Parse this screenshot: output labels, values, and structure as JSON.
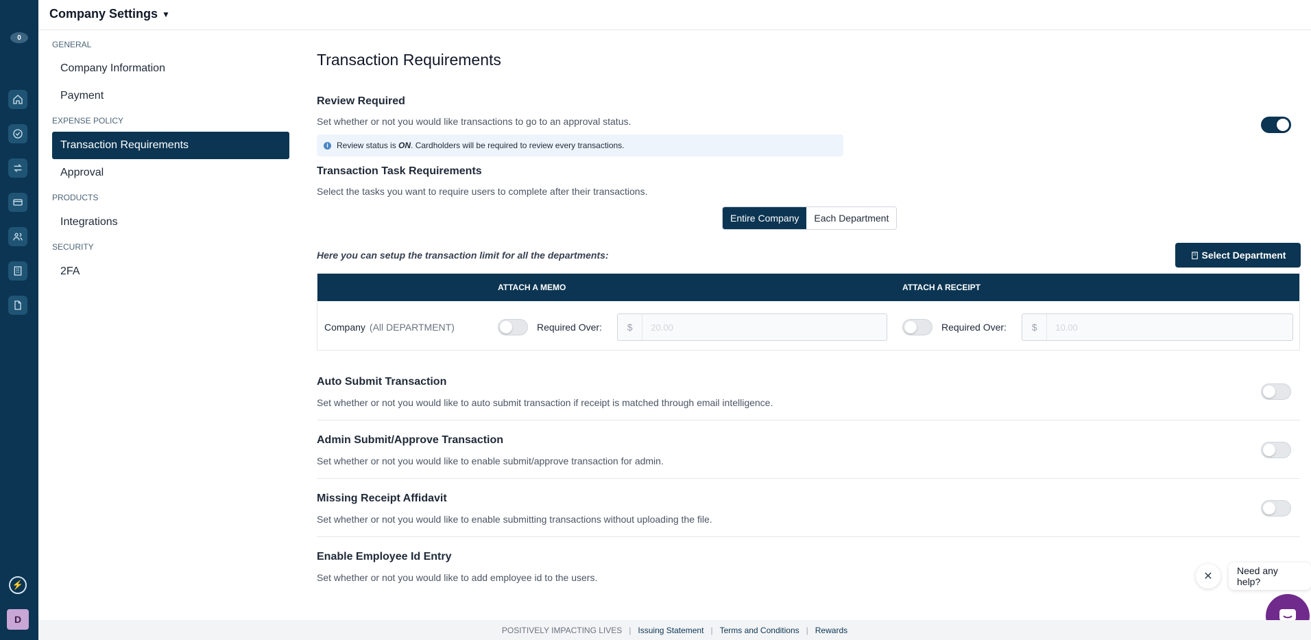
{
  "header": {
    "title": "Company Settings"
  },
  "rail": {
    "logo_badge": "0",
    "avatar_initial": "D"
  },
  "nav": {
    "sections": [
      {
        "label": "GENERAL",
        "items": [
          "Company Information",
          "Payment"
        ]
      },
      {
        "label": "EXPENSE POLICY",
        "items": [
          "Transaction Requirements",
          "Approval"
        ]
      },
      {
        "label": "PRODUCTS",
        "items": [
          "Integrations"
        ]
      },
      {
        "label": "SECURITY",
        "items": [
          "2FA"
        ]
      }
    ],
    "active_item": "Transaction Requirements"
  },
  "main": {
    "page_title": "Transaction Requirements",
    "review": {
      "title": "Review Required",
      "desc": "Set whether or not you would like transactions to go to an approval status.",
      "enabled": true,
      "info_prefix": "Review status is ",
      "info_status": "ON",
      "info_suffix": ". Cardholders will be required to review every transactions."
    },
    "task_req": {
      "title": "Transaction Task Requirements",
      "desc": "Select the tasks you want to require users to complete after their transactions.",
      "scope_options": [
        "Entire Company",
        "Each Department"
      ],
      "scope_selected": "Entire Company",
      "note": "Here you can setup the transaction limit for all the departments:",
      "select_dept_label": "Select Department",
      "table": {
        "col_memo": "ATTACH A MEMO",
        "col_receipt": "ATTACH A RECEIPT",
        "row_label": "Company",
        "row_sub": "(All DEPARTMENT)",
        "memo_enabled": false,
        "memo_required_over_label": "Required Over:",
        "memo_currency": "$",
        "memo_placeholder": "20.00",
        "receipt_enabled": false,
        "receipt_required_over_label": "Required Over:",
        "receipt_currency": "$",
        "receipt_placeholder": "10.00"
      }
    },
    "settings": [
      {
        "title": "Auto Submit Transaction",
        "desc": "Set whether or not you would like to auto submit transaction if receipt is matched through email intelligence.",
        "enabled": false
      },
      {
        "title": "Admin Submit/Approve Transaction",
        "desc": "Set whether or not you would like to enable submit/approve transaction for admin.",
        "enabled": false
      },
      {
        "title": "Missing Receipt Affidavit",
        "desc": "Set whether or not you would like to enable submitting transactions without uploading the file.",
        "enabled": false
      },
      {
        "title": "Enable Employee Id Entry",
        "desc": "Set whether or not you would like to add employee id to the users.",
        "enabled": false
      }
    ]
  },
  "footer": {
    "tagline": "POSITIVELY IMPACTING LIVES",
    "links": [
      "Issuing Statement",
      "Terms and Conditions",
      "Rewards"
    ]
  },
  "help": {
    "bubble_text": "Need any help?",
    "close_glyph": "✕"
  },
  "colors": {
    "brand_navy": "#0b3552",
    "chat_purple": "#6f2a8b"
  }
}
